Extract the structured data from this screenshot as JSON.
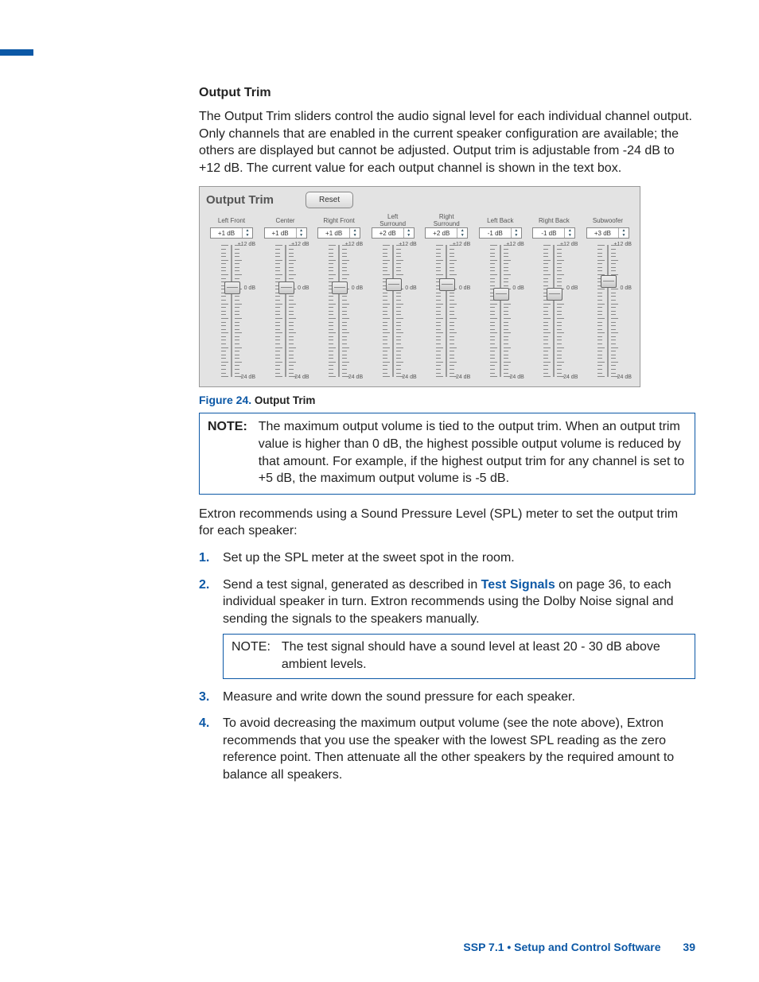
{
  "section_heading": "Output Trim",
  "intro_paragraph": "The Output Trim sliders control the audio signal level for each individual channel output. Only channels that are enabled in the current speaker configuration are available; the others are displayed but cannot be adjusted. Output trim is adjustable from -24 dB to +12 dB. The current value for each output channel is shown in the text box.",
  "screenshot": {
    "title": "Output Trim",
    "reset_label": "Reset",
    "top_label": "+12 dB",
    "mid_label": "0 dB",
    "bottom_label": "-24 dB",
    "channels": [
      {
        "name": "Left Front",
        "value": "+1 dB",
        "thumb": 48
      },
      {
        "name": "Center",
        "value": "+1 dB",
        "thumb": 48
      },
      {
        "name": "Right Front",
        "value": "+1 dB",
        "thumb": 48
      },
      {
        "name": "Left\nSurround",
        "value": "+2 dB",
        "thumb": 44
      },
      {
        "name": "Right\nSurround",
        "value": "+2 dB",
        "thumb": 44
      },
      {
        "name": "Left Back",
        "value": "-1 dB",
        "thumb": 56
      },
      {
        "name": "Right Back",
        "value": "-1 dB",
        "thumb": 56
      },
      {
        "name": "Subwoofer",
        "value": "+3 dB",
        "thumb": 40
      }
    ]
  },
  "figure_caption": {
    "label": "Figure 24.",
    "text": "Output Trim"
  },
  "note1": {
    "label": "NOTE:",
    "text": "The maximum output volume is tied to the output trim. When an output trim value is higher than 0 dB, the highest possible output volume is reduced by that amount. For example, if the highest output trim for any channel is set to +5 dB, the maximum output volume is -5 dB."
  },
  "recommendation": "Extron recommends using a Sound Pressure Level (SPL) meter to set the output trim for each speaker:",
  "steps": {
    "s1": "Set up the SPL meter at the sweet spot in the room.",
    "s2_pre": "Send a test signal, generated as described in ",
    "s2_link": "Test Signals",
    "s2_post": " on page 36, to each individual speaker in turn. Extron recommends using the Dolby Noise signal and sending the signals to the speakers manually.",
    "s2_note_label": "NOTE:",
    "s2_note": "The test signal should have a sound level at least 20 - 30 dB above ambient levels.",
    "s3": "Measure and write down the sound pressure for each speaker.",
    "s4": "To avoid decreasing the maximum output volume (see the note above), Extron recommends that you use the speaker with the lowest SPL reading as the zero reference point. Then attenuate all the other speakers by the required amount to balance all speakers."
  },
  "footer": {
    "text": "SSP 7.1 • Setup and Control Software",
    "page": "39"
  }
}
